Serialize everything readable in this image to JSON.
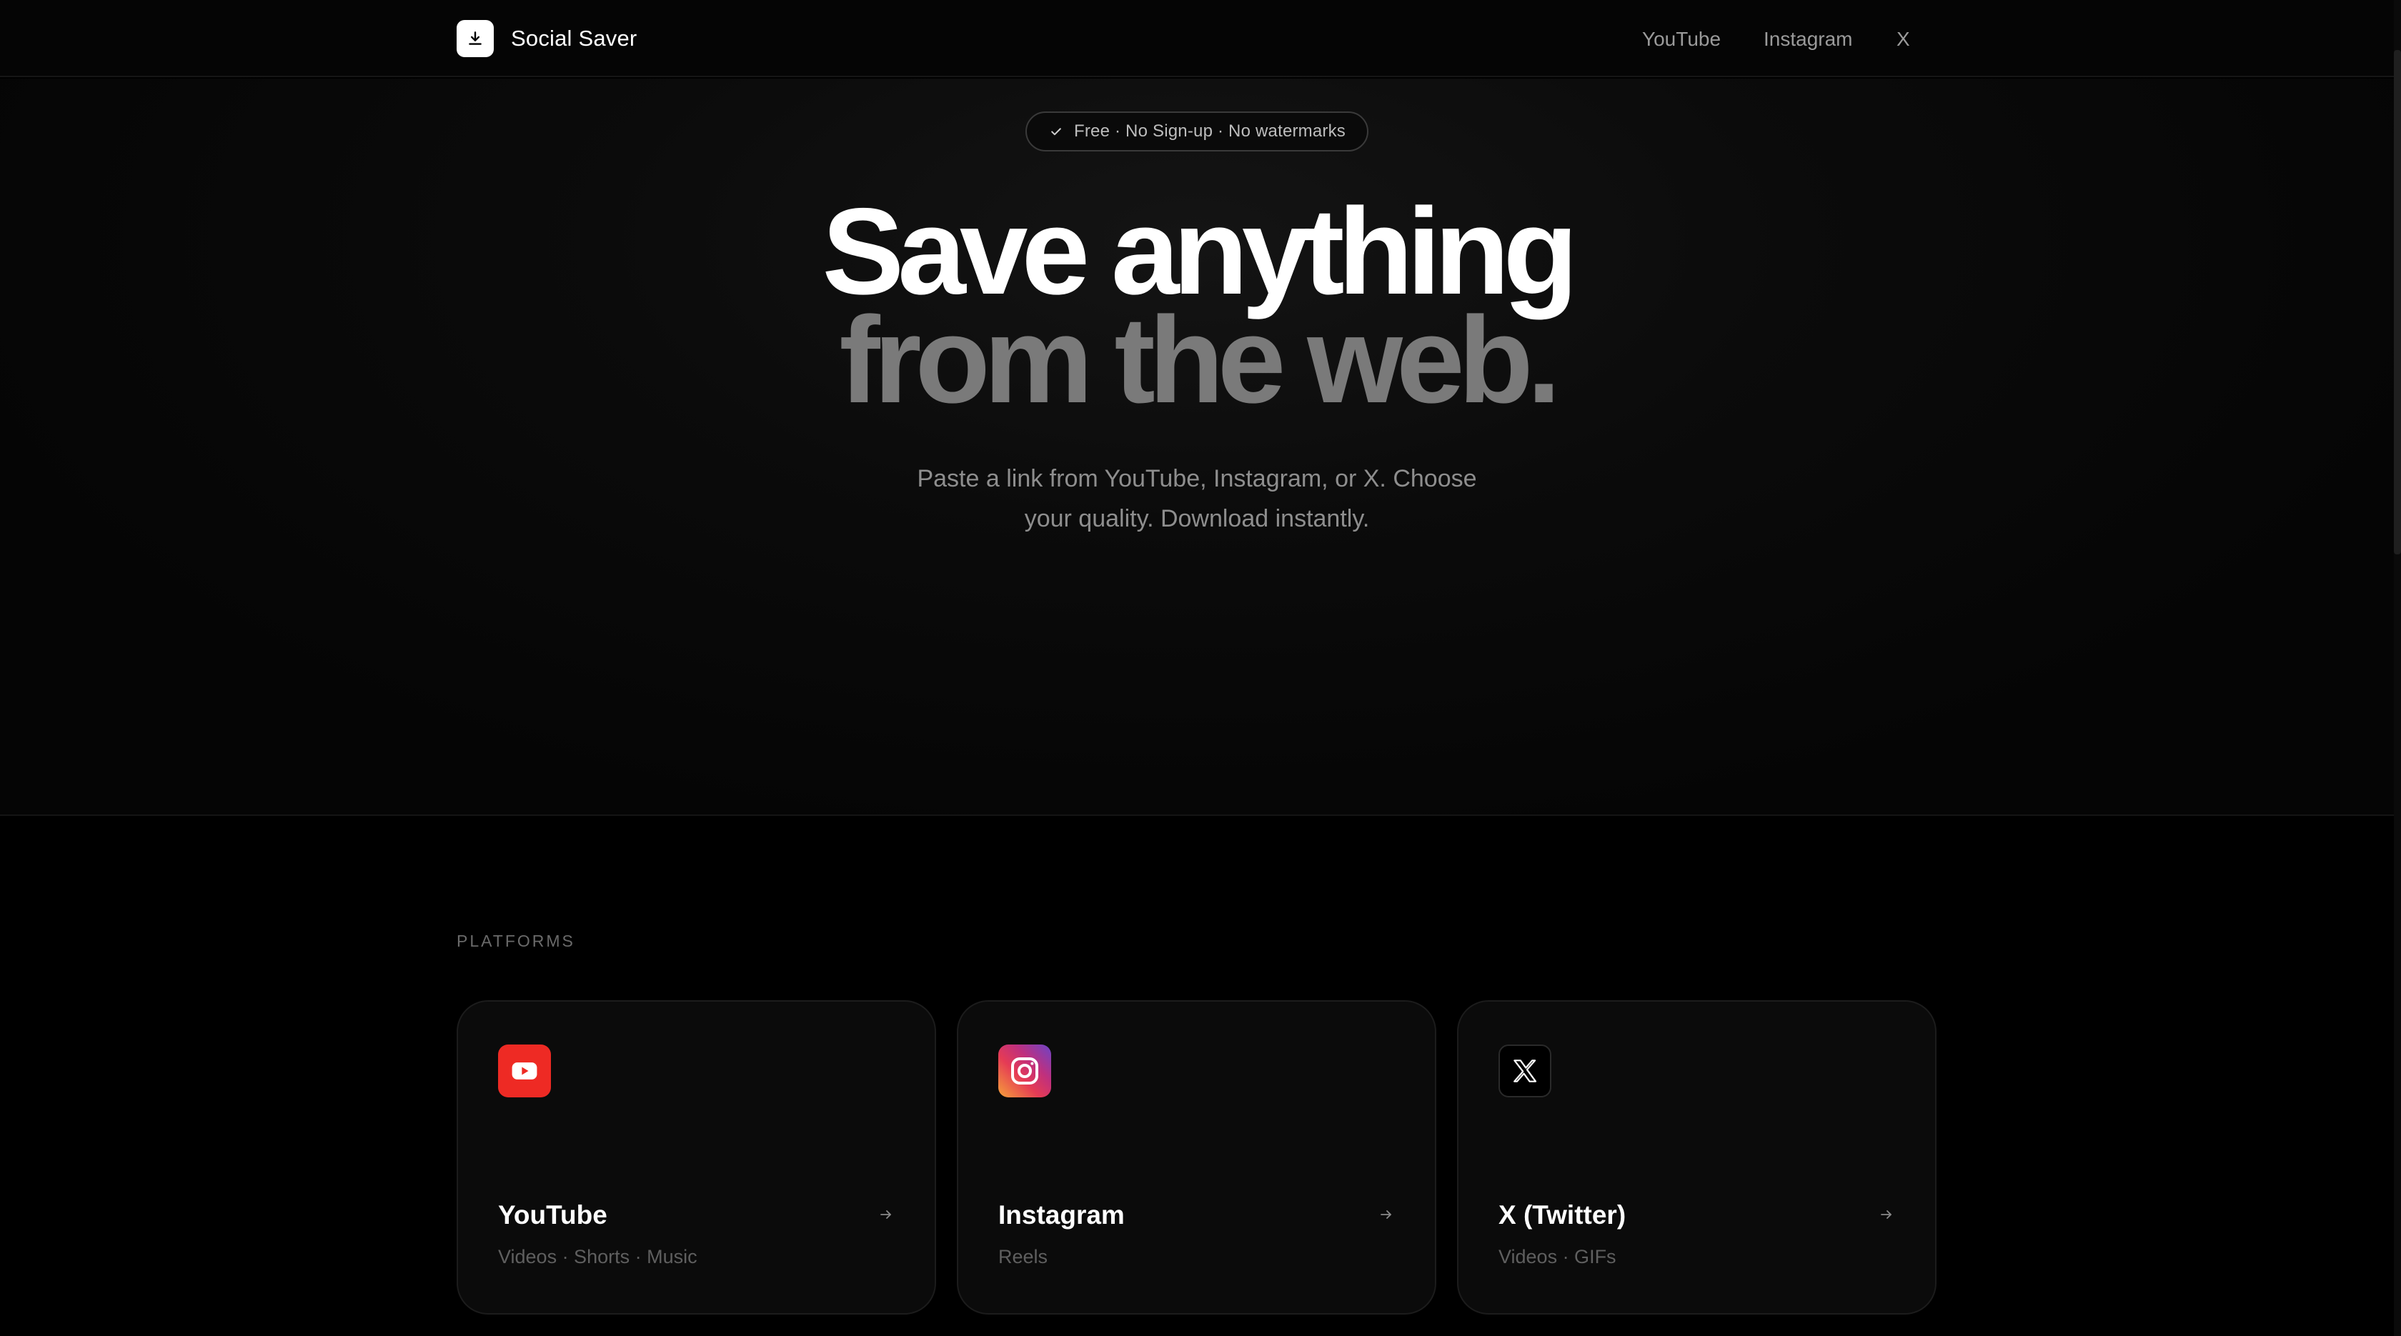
{
  "header": {
    "brand_name": "Social Saver",
    "nav": {
      "youtube": "YouTube",
      "instagram": "Instagram",
      "x": "X"
    }
  },
  "hero": {
    "badge": "Free · No Sign-up · No watermarks",
    "headline_line1": "Save anything",
    "headline_line2": "from the web.",
    "subtitle": "Paste a link from YouTube, Instagram, or X. Choose your quality. Download instantly."
  },
  "platforms": {
    "section_label": "PLATFORMS",
    "cards": [
      {
        "title": "YouTube",
        "subtitle": "Videos · Shorts · Music",
        "icon": "youtube-icon",
        "color": "#ee2a24"
      },
      {
        "title": "Instagram",
        "subtitle": "Reels",
        "icon": "instagram-icon",
        "color": "#e53b55"
      },
      {
        "title": "X (Twitter)",
        "subtitle": "Videos · GIFs",
        "icon": "x-icon",
        "color": "#000000"
      }
    ]
  },
  "colors": {
    "background": "#000000",
    "text_primary": "#ffffff",
    "text_muted": "#8e8e8e",
    "headline_secondary": "#7a7a7a"
  }
}
